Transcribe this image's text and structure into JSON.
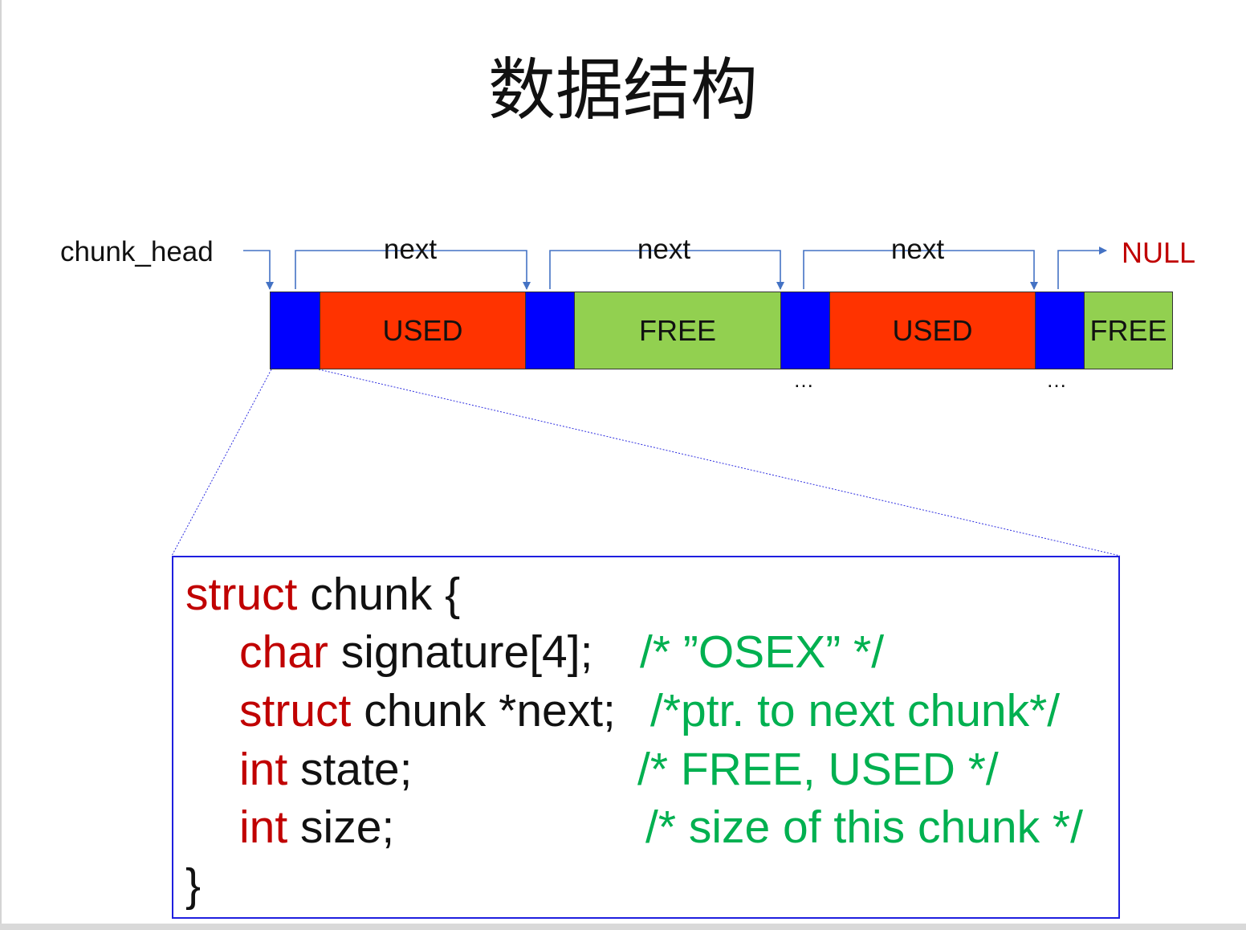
{
  "title": "数据结构",
  "diagram": {
    "chunk_head_label": "chunk_head",
    "next_labels": [
      "next",
      "next",
      "next"
    ],
    "null_label": "NULL",
    "blocks": [
      {
        "kind": "header"
      },
      {
        "kind": "data",
        "state": "USED"
      },
      {
        "kind": "header"
      },
      {
        "kind": "data",
        "state": "FREE"
      },
      {
        "kind": "header"
      },
      {
        "kind": "data",
        "state": "USED"
      },
      {
        "kind": "header"
      },
      {
        "kind": "data",
        "state": "FREE"
      }
    ],
    "ellipses": [
      "…",
      "…"
    ],
    "colors": {
      "header": "#0000ff",
      "used": "#ff3300",
      "free": "#92d050",
      "arrow": "#4472c4",
      "null": "#c00000"
    }
  },
  "code": {
    "line1": {
      "kw": "struct",
      "text": " chunk {"
    },
    "line2": {
      "kw": "char",
      "text": " signature[4];",
      "comment": "/* ”OSEX” */"
    },
    "line3": {
      "kw": "struct",
      "text": " chunk *next;",
      "comment": "/*ptr. to next chunk*/"
    },
    "line4": {
      "kw": "int",
      "text": " state;",
      "comment": "/* FREE, USED */"
    },
    "line5": {
      "kw": "int",
      "text": " size;",
      "comment": "/* size of this chunk */"
    },
    "line6": {
      "text": "}"
    },
    "colors": {
      "keyword": "#c00000",
      "comment": "#00b050"
    }
  }
}
